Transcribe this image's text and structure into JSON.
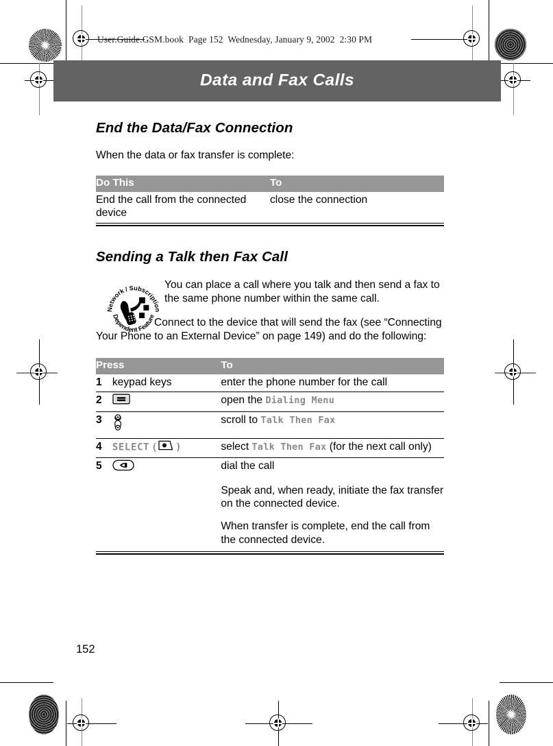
{
  "running_head": "User.Guide.GSM.book  Page 152  Wednesday, January 9, 2002  2:30 PM",
  "chapter": {
    "title": "Data and Fax Calls",
    "band_color": "#636363"
  },
  "sections": [
    {
      "heading": "End the Data/Fax Connection",
      "intro": "When the data or fax transfer is complete:",
      "table": {
        "headers": [
          "Do This",
          "To"
        ],
        "header_bg": "#969696",
        "rows": [
          {
            "do": "End the call from the connected device",
            "to": "close the connection"
          }
        ]
      }
    },
    {
      "heading": "Sending a Talk then Fax Call",
      "badge": {
        "top_arc": "Network / Subscription",
        "bottom_arc": "Dependent  Feature",
        "icon": "network-subscription-dependent-feature-badge"
      },
      "paragraphs": [
        "You can place a call where you talk and then send a fax to the same phone number within the same call.",
        "Connect to the device that will send the fax (see “Connecting Your Phone to an External Device” on page 149) and do the following:"
      ],
      "table": {
        "headers": [
          "Press",
          "To"
        ],
        "header_bg": "#969696",
        "rows": [
          {
            "num": "1",
            "press_text": "keypad keys",
            "press_icon": "",
            "to_prefix": "enter the phone number for the call",
            "to_mono": "",
            "to_suffix": ""
          },
          {
            "num": "2",
            "press_text": "",
            "press_icon": "menu-key-icon",
            "to_prefix": "open the ",
            "to_mono": "Dialing Menu",
            "to_suffix": ""
          },
          {
            "num": "3",
            "press_text": "",
            "press_icon": "scroll-key-icon",
            "to_prefix": "scroll to ",
            "to_mono": "Talk Then Fax",
            "to_suffix": ""
          },
          {
            "num": "4",
            "press_text": "SELECT",
            "press_icon": "softkey-icon",
            "press_paren_open": "(",
            "press_paren_close": ")",
            "to_prefix": "select ",
            "to_mono": "Talk Then Fax",
            "to_suffix": " (for the next call only)"
          },
          {
            "num": "5",
            "press_text": "",
            "press_icon": "send-key-icon",
            "to_prefix": "dial the call",
            "to_mono": "",
            "to_suffix": ""
          }
        ],
        "extra_notes": [
          "Speak and, when ready, initiate the fax transfer on the connected device.",
          "When transfer is complete, end the call from the connected device."
        ]
      }
    }
  ],
  "folio": "152"
}
